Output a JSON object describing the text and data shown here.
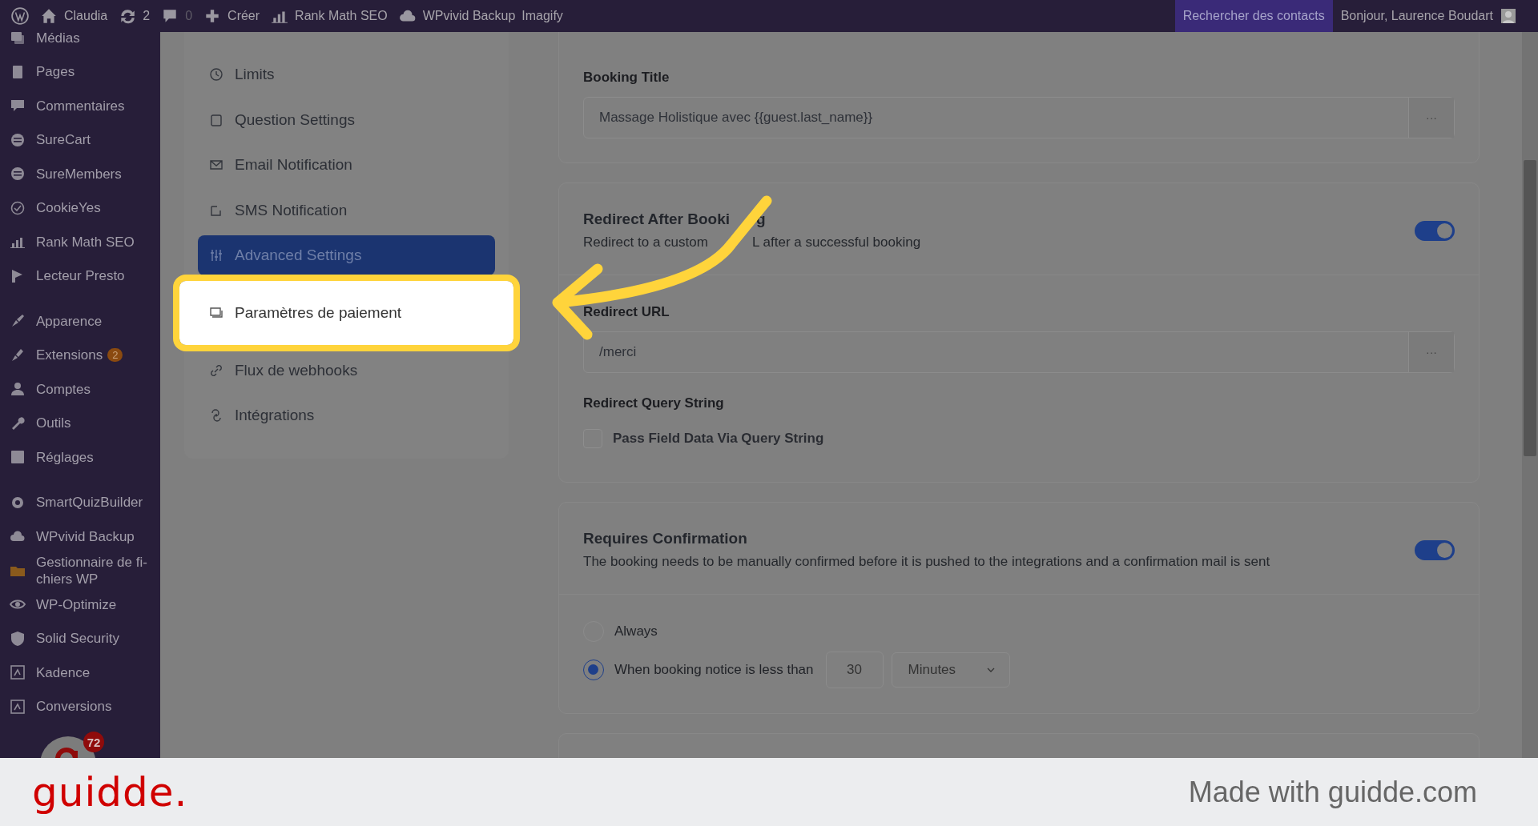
{
  "admin_bar": {
    "items": [
      {
        "kind": "logo"
      },
      {
        "kind": "home",
        "label": "Claudia"
      },
      {
        "kind": "updates",
        "label": "2"
      },
      {
        "kind": "comments",
        "label": "0"
      },
      {
        "kind": "new",
        "label": "Créer"
      },
      {
        "kind": "chart",
        "label": "Rank Math SEO"
      },
      {
        "kind": "cloud",
        "label": "WPvivid Backup"
      },
      {
        "kind": "plain",
        "label": "Imagify"
      }
    ],
    "search_contacts": "Rechercher des contacts",
    "greeting": "Bonjour, Laurence Boudart"
  },
  "sidebar": {
    "groups": [
      [
        {
          "label": "Médias"
        },
        {
          "label": "Pages"
        },
        {
          "label": "Commentaires"
        },
        {
          "label": "SureCart"
        },
        {
          "label": "SureMembers"
        },
        {
          "label": "CookieYes"
        },
        {
          "label": "Rank Math SEO"
        },
        {
          "label": "Lecteur Presto"
        }
      ],
      [
        {
          "label": "Apparence"
        },
        {
          "label": "Extensions",
          "badge": "2"
        },
        {
          "label": "Comptes"
        },
        {
          "label": "Outils"
        },
        {
          "label": "Réglages"
        }
      ],
      [
        {
          "label": "SmartQuizBuilder"
        },
        {
          "label": "WPvivid Backup"
        },
        {
          "label": "Gestionnaire de fi-\nchiers WP"
        },
        {
          "label": "WP-Optimize"
        },
        {
          "label": "Solid Security"
        },
        {
          "label": "Kadence"
        },
        {
          "label": "Conversions"
        }
      ]
    ]
  },
  "settings_menu": {
    "items": [
      {
        "label": "Limits",
        "selected": false,
        "highlighted": false
      },
      {
        "label": "Question Settings",
        "selected": false,
        "highlighted": false
      },
      {
        "label": "Email Notification",
        "selected": false,
        "highlighted": false
      },
      {
        "label": "SMS Notification",
        "selected": false,
        "highlighted": false
      },
      {
        "label": "Advanced Settings",
        "selected": true,
        "highlighted": false
      },
      {
        "label": "Paramètres de paiement",
        "selected": false,
        "highlighted": true
      },
      {
        "label": "Flux de webhooks",
        "selected": false,
        "highlighted": false
      },
      {
        "label": "Intégrations",
        "selected": false,
        "highlighted": false
      }
    ]
  },
  "booking_title": {
    "label": "Booking Title",
    "value": "Massage Holistique avec {{guest.last_name}}",
    "button": "···"
  },
  "redirect": {
    "title_parts": [
      "Redirect After Booki",
      "g"
    ],
    "description_parts": [
      "Redirect to a custom",
      "L after a successful booking"
    ],
    "on": true,
    "url_label": "Redirect URL",
    "url_value": "/merci",
    "url_button": "···",
    "query_label": "Redirect Query String",
    "pass_field": {
      "label": "Pass Field Data Via Query String",
      "checked": false
    }
  },
  "confirmation": {
    "title": "Requires Confirmation",
    "description": "The booking needs to be manually confirmed before it is pushed to the integrations and a confirmation mail is sent",
    "on": true,
    "options": [
      {
        "label": "Always",
        "selected": false
      },
      {
        "label": "When booking notice is less than",
        "selected": true
      }
    ],
    "notice_value": "30",
    "notice_unit": "Minutes"
  },
  "guidde_badge": "72",
  "footer": {
    "logo": "guidde.",
    "credit": "Made with guidde.com"
  }
}
